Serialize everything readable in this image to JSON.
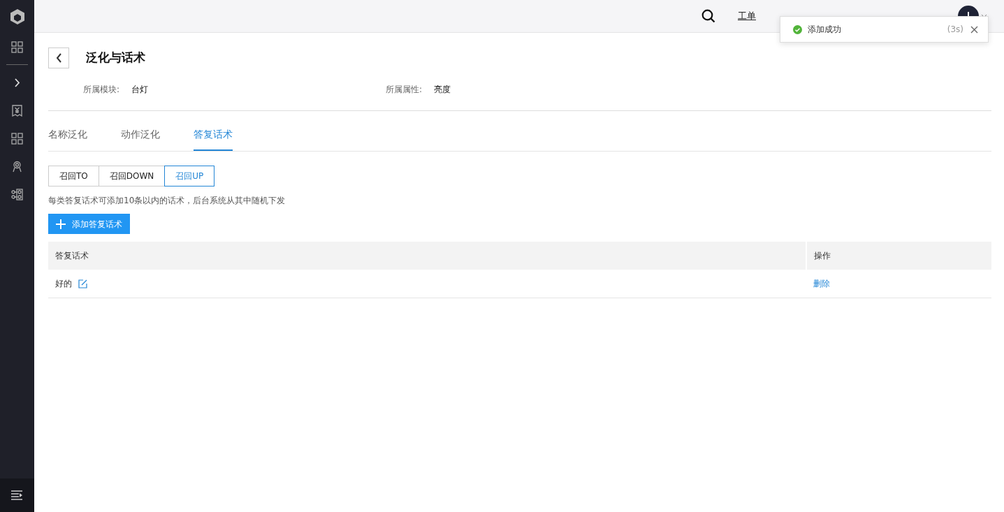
{
  "sidebar": {
    "items": [
      {
        "kind": "grid",
        "selected": false
      },
      {
        "kind": "expand",
        "selected": false
      },
      {
        "kind": "bill",
        "selected": false
      },
      {
        "kind": "grid",
        "selected": false
      },
      {
        "kind": "badge",
        "selected": false
      },
      {
        "kind": "flow",
        "selected": false
      }
    ]
  },
  "topbar": {
    "nav": [
      "工单"
    ]
  },
  "toast": {
    "text": "添加成功",
    "countdown": "(3s)"
  },
  "page": {
    "title": "泛化与话术",
    "fields": [
      {
        "label": "所属模块:",
        "value": "台灯"
      },
      {
        "label": "所属属性:",
        "value": "亮度"
      }
    ]
  },
  "tabs": [
    {
      "label": "名称泛化",
      "selected": false
    },
    {
      "label": "动作泛化",
      "selected": false
    },
    {
      "label": "答复话术",
      "selected": true
    }
  ],
  "segments": [
    {
      "label": "召回TO",
      "selected": false
    },
    {
      "label": "召回DOWN",
      "selected": false
    },
    {
      "label": "召回UP",
      "selected": true
    }
  ],
  "hint": "每类答复话术可添加10条以内的话术，后台系统从其中随机下发",
  "add_button": "添加答复话术",
  "table": {
    "columns": [
      "答复话术",
      "操作"
    ],
    "rows": [
      {
        "text": "好的",
        "action": "删除"
      }
    ]
  }
}
